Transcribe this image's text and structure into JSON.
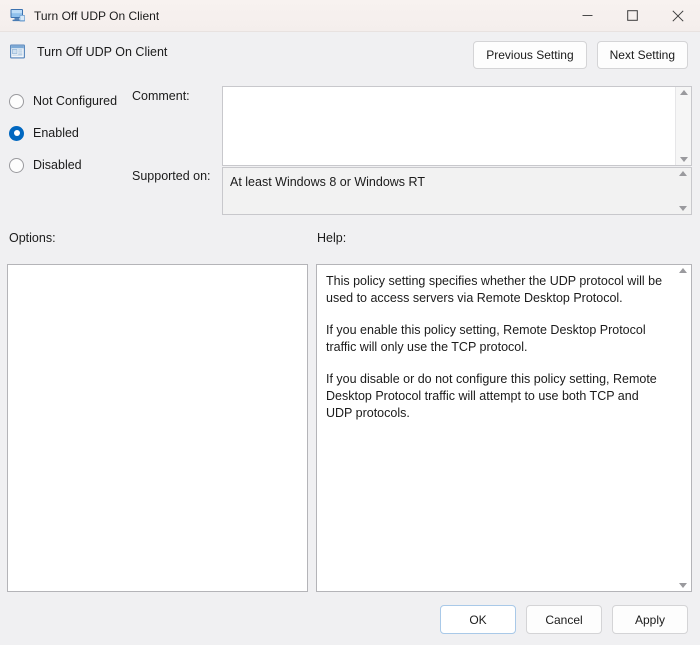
{
  "titlebar": {
    "icon": "computer-monitor-icon",
    "title": "Turn Off UDP On Client",
    "minimize_label": "─",
    "maximize_label": "□",
    "close_label": "✕"
  },
  "header": {
    "icon": "policy-setting-icon",
    "title": "Turn Off UDP On Client",
    "previous_setting_label": "Previous Setting",
    "next_setting_label": "Next Setting"
  },
  "state": {
    "options": [
      {
        "label": "Not Configured",
        "checked": false
      },
      {
        "label": "Enabled",
        "checked": true
      },
      {
        "label": "Disabled",
        "checked": false
      }
    ]
  },
  "comment": {
    "label": "Comment:",
    "value": "",
    "scroll_up_icon": "scroll-up-arrow-icon",
    "scroll_down_icon": "scroll-down-arrow-icon"
  },
  "supported_on": {
    "label": "Supported on:",
    "value": "At least Windows 8 or Windows RT"
  },
  "options_panel": {
    "label": "Options:",
    "value": ""
  },
  "help_panel": {
    "label": "Help:",
    "paragraphs": [
      "This policy setting specifies whether the UDP protocol will be used to access servers via Remote Desktop Protocol.",
      "If you enable this policy setting, Remote Desktop Protocol traffic will only use the TCP protocol.",
      "If you disable or do not configure this policy setting, Remote Desktop Protocol traffic will attempt to use both TCP and UDP protocols."
    ]
  },
  "footer": {
    "ok_label": "OK",
    "cancel_label": "Cancel",
    "apply_label": "Apply"
  },
  "colors": {
    "accent": "#0067c0",
    "default_button_border": "#a9c9e8",
    "dialog_background": "#f0f0f2",
    "titlebar_background": "#f6f0ee",
    "readonly_background": "#f2f2f2"
  }
}
